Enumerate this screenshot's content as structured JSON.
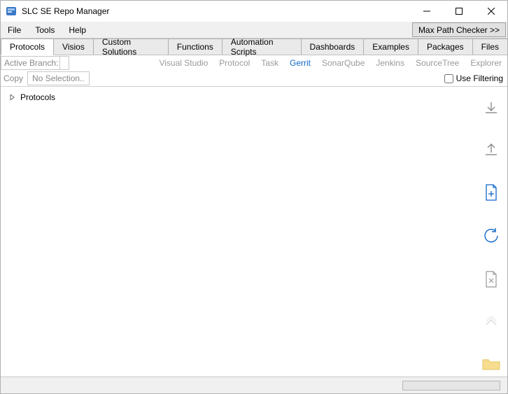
{
  "title": "SLC SE Repo Manager",
  "menu": {
    "file": "File",
    "tools": "Tools",
    "help": "Help",
    "maxpath": "Max Path Checker >>"
  },
  "tabs": [
    "Protocols",
    "Visios",
    "Custom Solutions",
    "Functions",
    "Automation Scripts",
    "Dashboards",
    "Examples",
    "Packages",
    "Files"
  ],
  "active_tab_index": 0,
  "branch_label": "Active Branch:",
  "links": [
    "Visual Studio",
    "Protocol",
    "Task",
    "Gerrit",
    "SonarQube",
    "Jenkins",
    "SourceTree",
    "Explorer"
  ],
  "active_link_index": 3,
  "copy_label": "Copy",
  "no_selection": "No Selection..",
  "use_filtering": "Use Filtering",
  "tree_root": "Protocols",
  "sidetools": [
    "download-icon",
    "upload-icon",
    "new-file-icon",
    "sync-icon",
    "delete-file-icon",
    "up-chevron-icon",
    "folder-icon"
  ]
}
